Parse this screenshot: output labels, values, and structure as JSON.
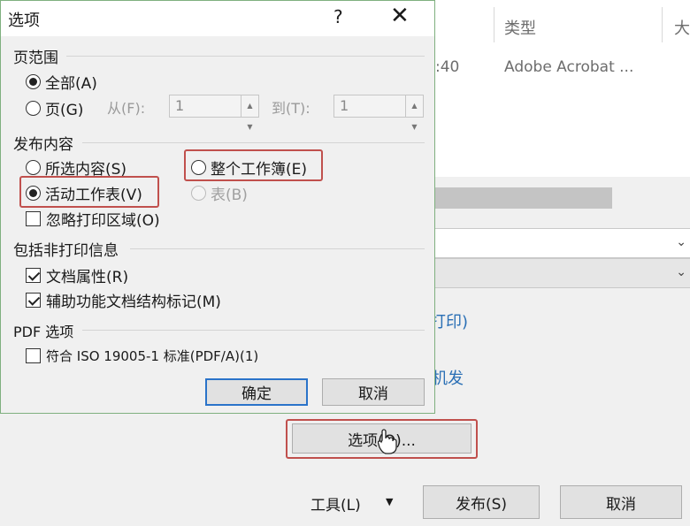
{
  "background": {
    "columns": {
      "type_header": "类型",
      "size_header_partial": "大"
    },
    "row": {
      "time_partial": ":40",
      "type_value": "Adobe Acrobat ..."
    },
    "links": {
      "print_partial": "打印)",
      "send_partial": "机发"
    },
    "options_button": "选项(O)...",
    "tools_label": "工具(L)",
    "tools_arrow": "▼",
    "publish_button": "发布(S)",
    "cancel_button": "取消"
  },
  "dialog": {
    "title": "选项",
    "help": "?",
    "close": "✕",
    "page_range": {
      "label": "页范围",
      "all": "全部(A)",
      "pages": "页(G)",
      "from_label": "从(F):",
      "from_value": "1",
      "to_label": "到(T):",
      "to_value": "1",
      "selected": "all"
    },
    "publish_what": {
      "label": "发布内容",
      "selection": "所选内容(S)",
      "entire_workbook": "整个工作簿(E)",
      "active_sheets": "活动工作表(V)",
      "table": "表(B)",
      "ignore_print_areas": "忽略打印区域(O)",
      "selected": "active_sheets",
      "ignore_print_areas_checked": false
    },
    "non_printing": {
      "label": "包括非打印信息",
      "doc_properties": "文档属性(R)",
      "doc_properties_checked": true,
      "accessibility_tags": "辅助功能文档结构标记(M)",
      "accessibility_tags_checked": true
    },
    "pdf_options": {
      "label": "PDF 选项",
      "iso": "符合 ISO 19005-1 标准(PDF/A)(1)",
      "iso_checked": false
    },
    "ok": "确定",
    "cancel": "取消"
  },
  "colors": {
    "highlight": "#c0504d",
    "ok_border": "#2a73c9",
    "link": "#2a6fb5"
  }
}
